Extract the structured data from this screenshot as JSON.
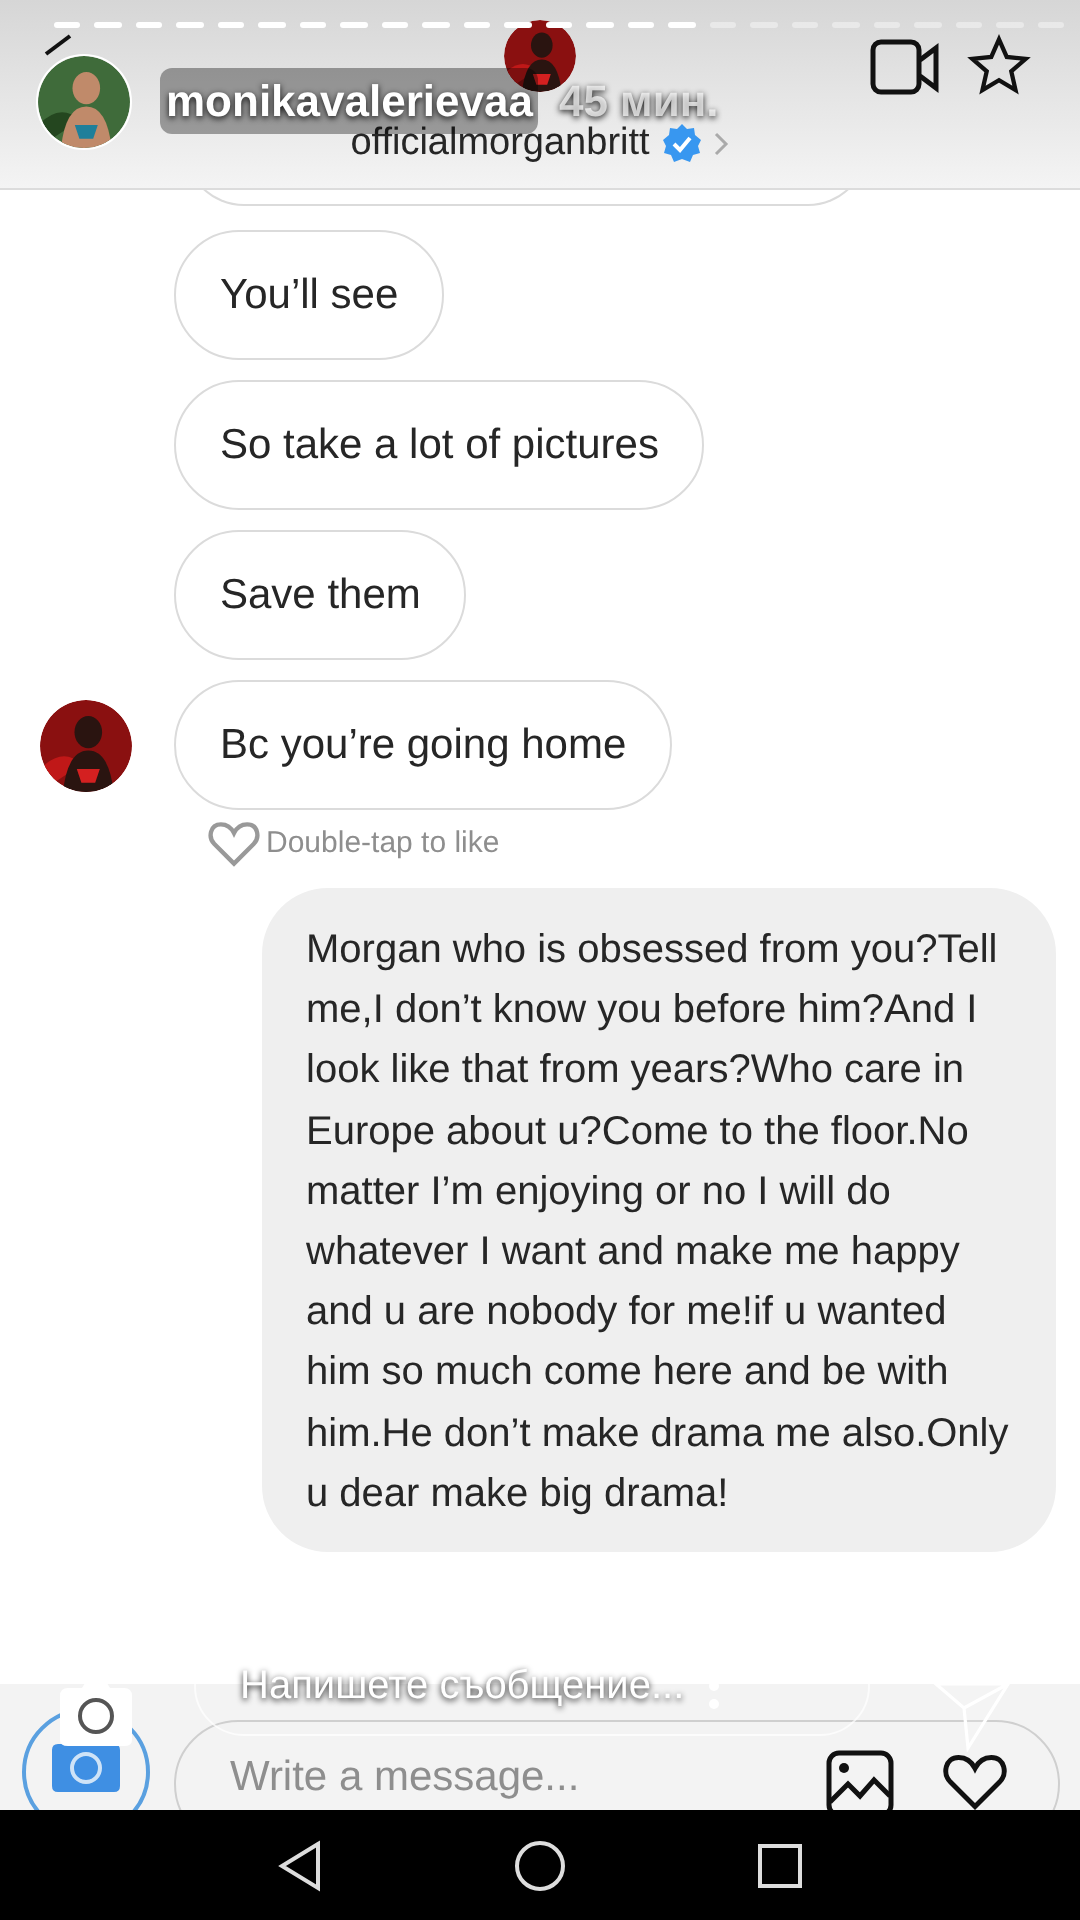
{
  "story": {
    "user": "monikavalerievaa",
    "time": "45 мин.",
    "reply_placeholder": "Напишете съобщение..."
  },
  "chat": {
    "header": {
      "username": "officialmorganbritt",
      "verified": true
    },
    "messages": [
      {
        "kind": "incoming",
        "text": "You’ll see",
        "avatar": false
      },
      {
        "kind": "incoming",
        "text": "So take a lot of pictures",
        "avatar": false
      },
      {
        "kind": "incoming",
        "text": "Save them",
        "avatar": false
      },
      {
        "kind": "incoming",
        "text": "Bc you’re going home",
        "avatar": true
      },
      {
        "kind": "like_hint",
        "text": "Double-tap to like"
      },
      {
        "kind": "outgoing",
        "text": "Morgan who is obsessed from you?Tell me,I don’t know you before him?And I look like that from years?Who care in Europe about u?Come to the floor.No matter I’m enjoying or no I will do whatever I want and make me happy and u are nobody for me!if u wanted him so much come here and be with him.He don’t make drama me also.Only u dear make big drama!"
      }
    ],
    "composer": {
      "placeholder": "Write a message..."
    }
  }
}
